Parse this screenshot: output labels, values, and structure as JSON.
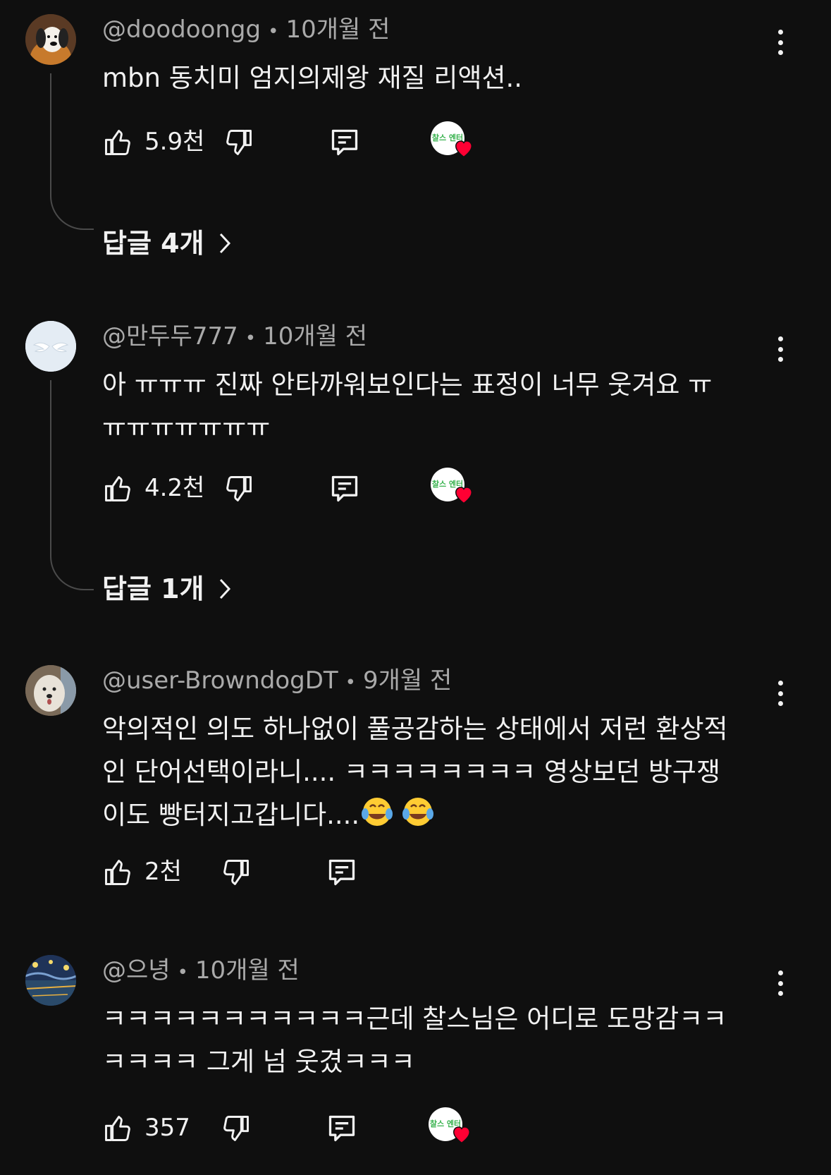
{
  "comments": [
    {
      "handle": "@doodoongg",
      "time": "10개월 전",
      "text": "mbn 동치미 엄지의제왕 재질 리액션..",
      "likes": "5.9천",
      "creator_heart": true,
      "creator_label": "찰스 엔터",
      "replies_label": "답글 4개",
      "avatar": "snoopy-avatar"
    },
    {
      "handle": "@만두두777",
      "time": "10개월 전",
      "text": "아 ㅠㅠㅠ 진짜 안타까워보인다는 표정이 너무 웃겨요 ㅠ\nㅠㅠㅠㅠㅠㅠㅠ",
      "likes": "4.2천",
      "creator_heart": true,
      "creator_label": "찰스 엔터",
      "replies_label": "답글 1개",
      "avatar": "wings-avatar"
    },
    {
      "handle": "@user-BrowndogDT",
      "time": "9개월 전",
      "text_main": "악의적인 의도 하나없이 풀공감하는 상태에서 저런 환상적\n인 단어선택이라니.... ㅋㅋㅋㅋㅋㅋㅋㅋ 영상보던 방구쟁\n이도 빵터지고갑니다....",
      "emoji": "joy-emoji",
      "likes": "2천",
      "creator_heart": false,
      "avatar": "white-dog-avatar"
    },
    {
      "handle": "@으녕",
      "time": "10개월 전",
      "text": "ㅋㅋㅋㅋㅋㅋㅋㅋㅋㅋㅋ근데 찰스님은 어디로 도망감ㅋㅋ\nㅋㅋㅋㅋ 그게 넘 웃겼ㅋㅋㅋ",
      "likes": "357",
      "creator_heart": true,
      "creator_label": "찰스 엔터",
      "avatar": "starry-night-avatar"
    }
  ],
  "colors": {
    "background": "#0f0f0f",
    "text": "#f1f1f1",
    "meta": "#aaaaaa",
    "heart": "#ff0033"
  }
}
